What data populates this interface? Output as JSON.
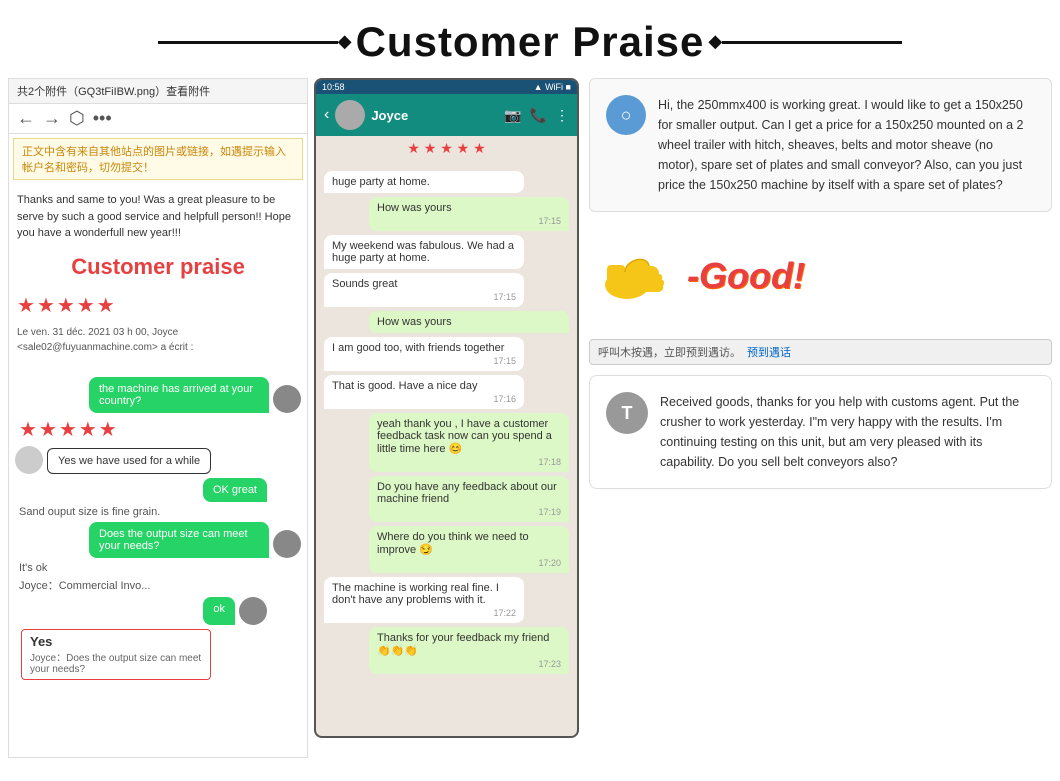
{
  "header": {
    "title": "Customer Praise"
  },
  "email_panel": {
    "attachment_label": "共2个附件（GQ3tFiIBW.png）查看附件",
    "warning": "正文中含有来自其他站点的图片或链接，如遇提示输入帐户名和密码，切勿提交！",
    "body_text": "Thanks and same to you! Was a great pleasure to be serve by such a good service and helpfull person!! Hope you have a wonderfull new year!!!",
    "praise_title": "Customer praise",
    "from_line": "Le ven. 31 déc. 2021 03 h 00, Joyce <sale02@fuyuanmachine.com> a écrit :",
    "chat": {
      "bubble1": "the machine has arrived at your country?",
      "stars_label": "★★★★★",
      "bubble2": "Yes we have used for a while",
      "bubble3": "OK great",
      "static1": "Sand ouput size is fine grain.",
      "bubble4": "Does the output size can meet your needs?",
      "static2": "It's ok",
      "file_label": "Joyce：Commercial Invo...",
      "bubble5": "ok",
      "yes_title": "Yes",
      "yes_sub": "Joyce：Does the output size can meet your needs?"
    }
  },
  "whatsapp_panel": {
    "status_bar": "10:58",
    "signal": "▲ WiFi ■",
    "contact_name": "Joyce",
    "stars": "★ ★ ★ ★ ★",
    "messages": [
      {
        "side": "left",
        "text": "huge party at home.",
        "time": ""
      },
      {
        "side": "right",
        "text": "How was yours",
        "time": "17:15"
      },
      {
        "side": "left",
        "text": "My weekend was fabulous. We had a huge party at home.",
        "time": ""
      },
      {
        "side": "left",
        "text": "Sounds great",
        "time": "17:15"
      },
      {
        "side": "right",
        "text": "How was yours",
        "time": ""
      },
      {
        "side": "left",
        "text": "I am good too, with friends together",
        "time": "17:15"
      },
      {
        "side": "left",
        "text": "That is good. Have a nice day",
        "time": "17:16"
      },
      {
        "side": "right",
        "text": "yeah thank you , I have a customer feedback task now can you spend a little time here 😊",
        "time": "17:18"
      },
      {
        "side": "right",
        "text": "Do you have any feedback about our machine friend",
        "time": "17:19"
      },
      {
        "side": "right",
        "text": "Where do you think we need to improve 😏",
        "time": "17:20"
      },
      {
        "side": "left",
        "text": "The machine is working real fine. I don't have any problems with it.",
        "time": "17:22"
      },
      {
        "side": "right",
        "text": "Thanks for your feedback my friend 👏👏👏",
        "time": "17:23"
      }
    ]
  },
  "right_panel": {
    "inquiry": {
      "icon": "○",
      "text": "Hi, the 250mmx400 is working great. I would like to get a 150x250 for smaller output. Can I get a price for a 150x250 mounted on a 2 wheel trailer with hitch, sheaves, belts and motor sheave (no motor), spare set of plates and small conveyor? Also, can you just price the 150x250 machine by itself with a spare set of plates?"
    },
    "good_label": "-Good!",
    "wechat": {
      "call_text": "呼叫木按遇，立即预到遇访。",
      "call_link": "预到遇话"
    },
    "testimonial": {
      "avatar": "T",
      "text": "Received goods, thanks for you help with customs agent. Put the crusher to work yesterday. I\"m very happy with the results. I'm continuing testing on this unit, but am very pleased with its capability. Do you sell belt conveyors also?"
    }
  }
}
